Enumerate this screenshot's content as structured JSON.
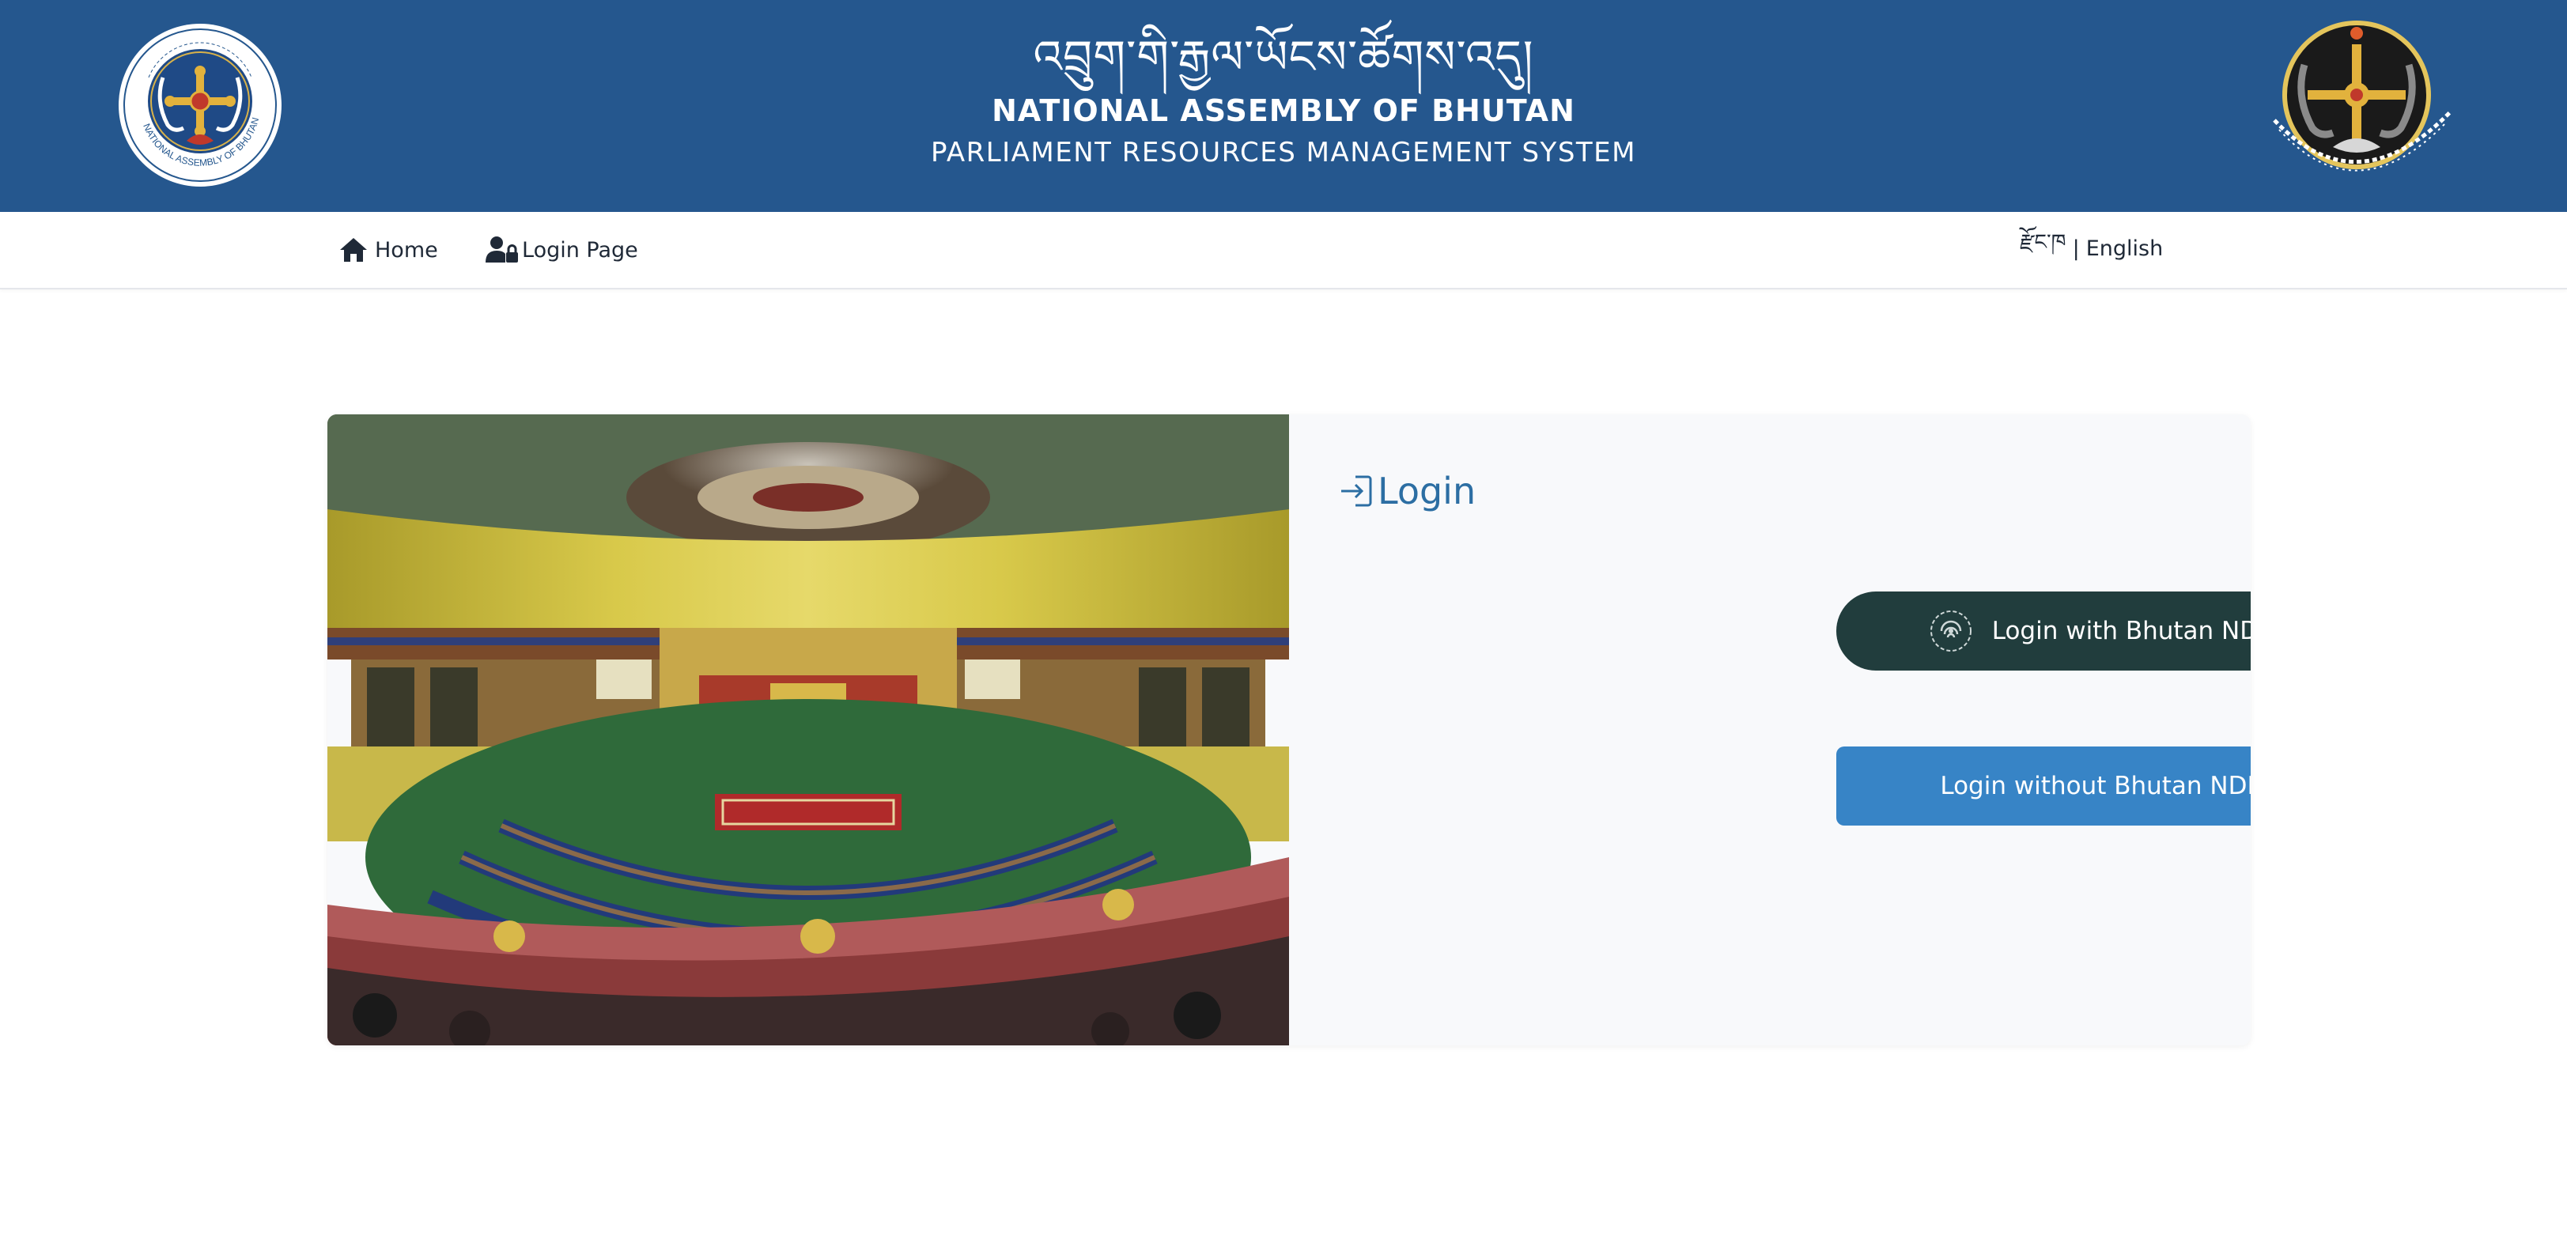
{
  "colors": {
    "banner_bg": "#25578e",
    "ndi_button_bg": "#213d3d",
    "plain_button_bg": "#3784c6",
    "login_title": "#2c6ea3"
  },
  "header": {
    "dzongkha_title": "འབྲུག་གི་རྒྱལ་ཡོངས་ཚོགས་འདུ།",
    "title": "NATIONAL ASSEMBLY OF BHUTAN",
    "subtitle": "PARLIAMENT RESOURCES MANAGEMENT SYSTEM",
    "left_logo_icon": "national-assembly-seal-icon",
    "right_logo_icon": "royal-emblem-icon",
    "left_logo_text": "NATIONAL ASSEMBLY OF BHUTAN"
  },
  "nav": {
    "home": {
      "label": "Home",
      "icon": "home-icon"
    },
    "login": {
      "label": "Login Page",
      "icon": "user-lock-icon"
    },
    "language": {
      "dzongkha": "རྫོང་ཁ",
      "separator": "|",
      "english": "English"
    }
  },
  "main": {
    "image_description_icon": "parliament-chamber-photo",
    "login": {
      "title": "Login",
      "title_icon": "sign-in-icon",
      "ndi_button": "Login with Bhutan NDI",
      "ndi_icon": "ndi-fingerprint-icon",
      "plain_button": "Login without Bhutan NDI"
    }
  }
}
